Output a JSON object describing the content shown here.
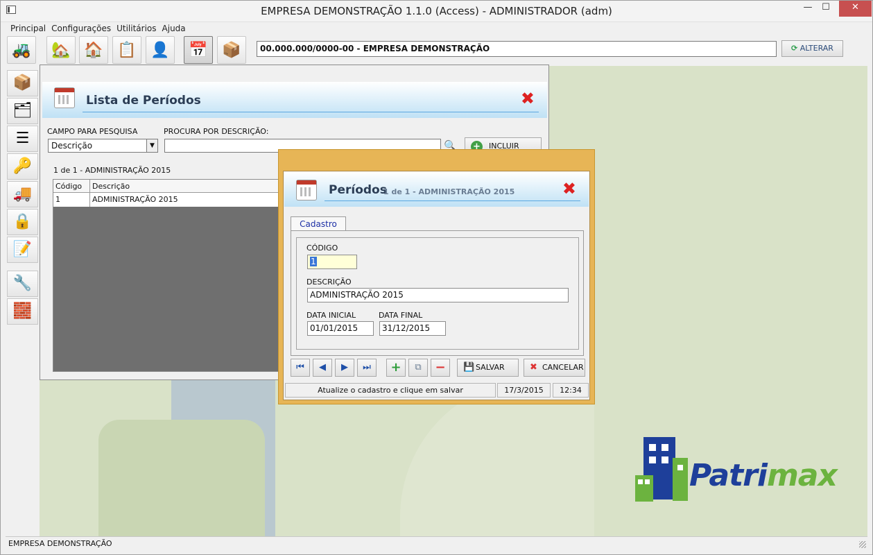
{
  "window": {
    "title": "EMPRESA DEMONSTRAÇÃO 1.1.0 (Access) - ADMINISTRADOR (adm)",
    "min_glyph": "—",
    "max_glyph": "☐",
    "close_glyph": "✕"
  },
  "menu": [
    "Principal",
    "Configurações",
    "Utilitários",
    "Ajuda"
  ],
  "toolbar": {
    "company": "00.000.000/0000-00 - EMPRESA DEMONSTRAÇÃO",
    "alterar_label": "ALTERAR",
    "alterar_glyph": "⟳",
    "icons": [
      {
        "name": "forklift-icon",
        "glyph": "🚜"
      },
      {
        "name": "house-green-icon",
        "glyph": "🏡"
      },
      {
        "name": "house-orange-icon",
        "glyph": "🏠"
      },
      {
        "name": "clipboard-icon",
        "glyph": "📋"
      },
      {
        "name": "user-icon",
        "glyph": "👤"
      },
      {
        "name": "calendar-icon",
        "glyph": "📅"
      },
      {
        "name": "open-box-icon",
        "glyph": "📦"
      }
    ]
  },
  "sidebar": [
    {
      "name": "box-icon",
      "glyph": "📦"
    },
    {
      "name": "org-chart-icon",
      "glyph": "🗂"
    },
    {
      "name": "list-icon",
      "glyph": "☰"
    },
    {
      "name": "keys-icon",
      "glyph": "🔑"
    },
    {
      "name": "truck-icon",
      "glyph": "🚚"
    },
    {
      "name": "lock-icon",
      "glyph": "🔒"
    },
    {
      "name": "document-icon",
      "glyph": "📝"
    },
    {
      "name": "tools-icon",
      "glyph": "🔧"
    },
    {
      "name": "brick-wall-icon",
      "glyph": "🧱"
    }
  ],
  "list_window": {
    "title": "Lista de Períodos",
    "close_glyph": "✖",
    "campo_label": "CAMPO PARA PESQUISA",
    "campo_value": "Descrição",
    "procura_label": "PROCURA POR DESCRIÇÃO:",
    "search_glyph": "🔍",
    "incluir_label": "INCLUIR",
    "incluir_glyph": "+",
    "count_label": "1 de 1 - ADMINISTRAÇÃO 2015",
    "columns": [
      "Código",
      "Descrição"
    ],
    "rows": [
      [
        "1",
        "ADMINISTRAÇÃO 2015"
      ]
    ]
  },
  "dialog": {
    "title": "Períodos",
    "subtitle": "1 de 1 - ADMINISTRAÇÃO 2015",
    "close_glyph": "✖",
    "tab": "Cadastro",
    "codigo_label": "CÓDIGO",
    "codigo_value": "1",
    "descricao_label": "DESCRIÇÃO",
    "descricao_value": "ADMINISTRAÇÃO 2015",
    "data_inicial_label": "DATA INICIAL",
    "data_inicial_value": "01/01/2015",
    "data_final_label": "DATA FINAL",
    "data_final_value": "31/12/2015",
    "nav": {
      "first": "⏮",
      "prev": "◀",
      "next": "▶",
      "last": "⏭",
      "add": "+",
      "copy": "⧉",
      "delete": "−"
    },
    "salvar_label": "SALVAR",
    "salvar_glyph": "💾",
    "cancelar_label": "CANCELAR",
    "cancelar_glyph": "✖",
    "status_msg": "Atualize o cadastro e clique em salvar",
    "status_date": "17/3/2015",
    "status_time": "12:34"
  },
  "logo": {
    "part1": "Patri",
    "part2": "max"
  },
  "statusbar": {
    "text": "EMPRESA DEMONSTRAÇÃO"
  }
}
